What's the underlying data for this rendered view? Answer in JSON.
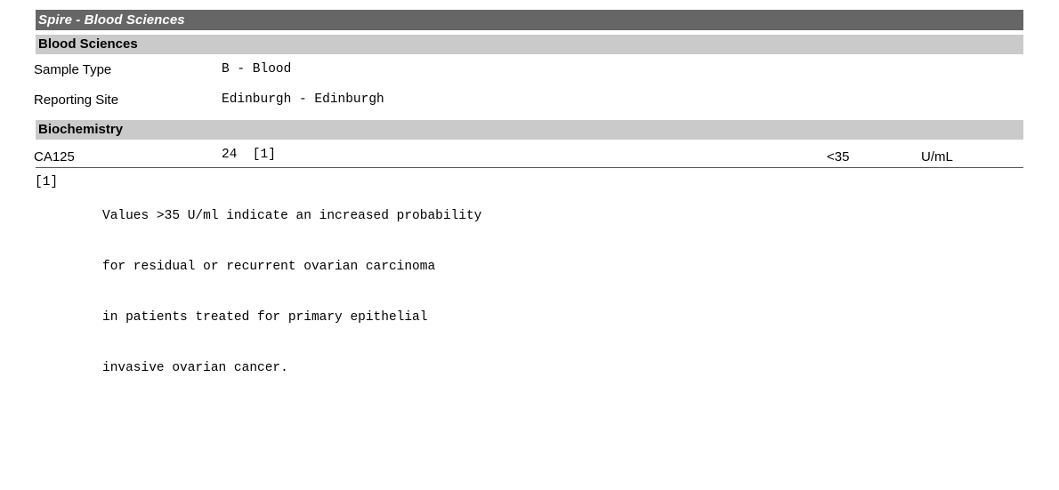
{
  "document": {
    "title_bar": {
      "label": "Spire - Blood Sciences"
    },
    "sections": [
      {
        "heading": "Blood Sciences",
        "fields": [
          {
            "label": "Sample Type",
            "value": "B - Blood"
          },
          {
            "label": "Reporting Site",
            "value": "Edinburgh - Edinburgh"
          }
        ]
      },
      {
        "heading": "Biochemistry",
        "results": [
          {
            "name": "CA125",
            "value": "24  [1]",
            "reference_range": "<35",
            "units": "U/mL"
          }
        ]
      }
    ],
    "footnotes": [
      {
        "marker": "[1]",
        "lines": [
          "Values >35 U/ml indicate an increased probability",
          "for residual or recurrent ovarian carcinoma",
          "in patients treated for primary epithelial",
          "invasive ovarian cancer."
        ]
      }
    ],
    "colors": {
      "title_bar_background": "#666666",
      "title_bar_text": "#ffffff",
      "section_bar_background": "#cacaca",
      "section_bar_text": "#000000",
      "rule": "#555555",
      "page_background": "#ffffff",
      "body_text": "#000000"
    }
  }
}
